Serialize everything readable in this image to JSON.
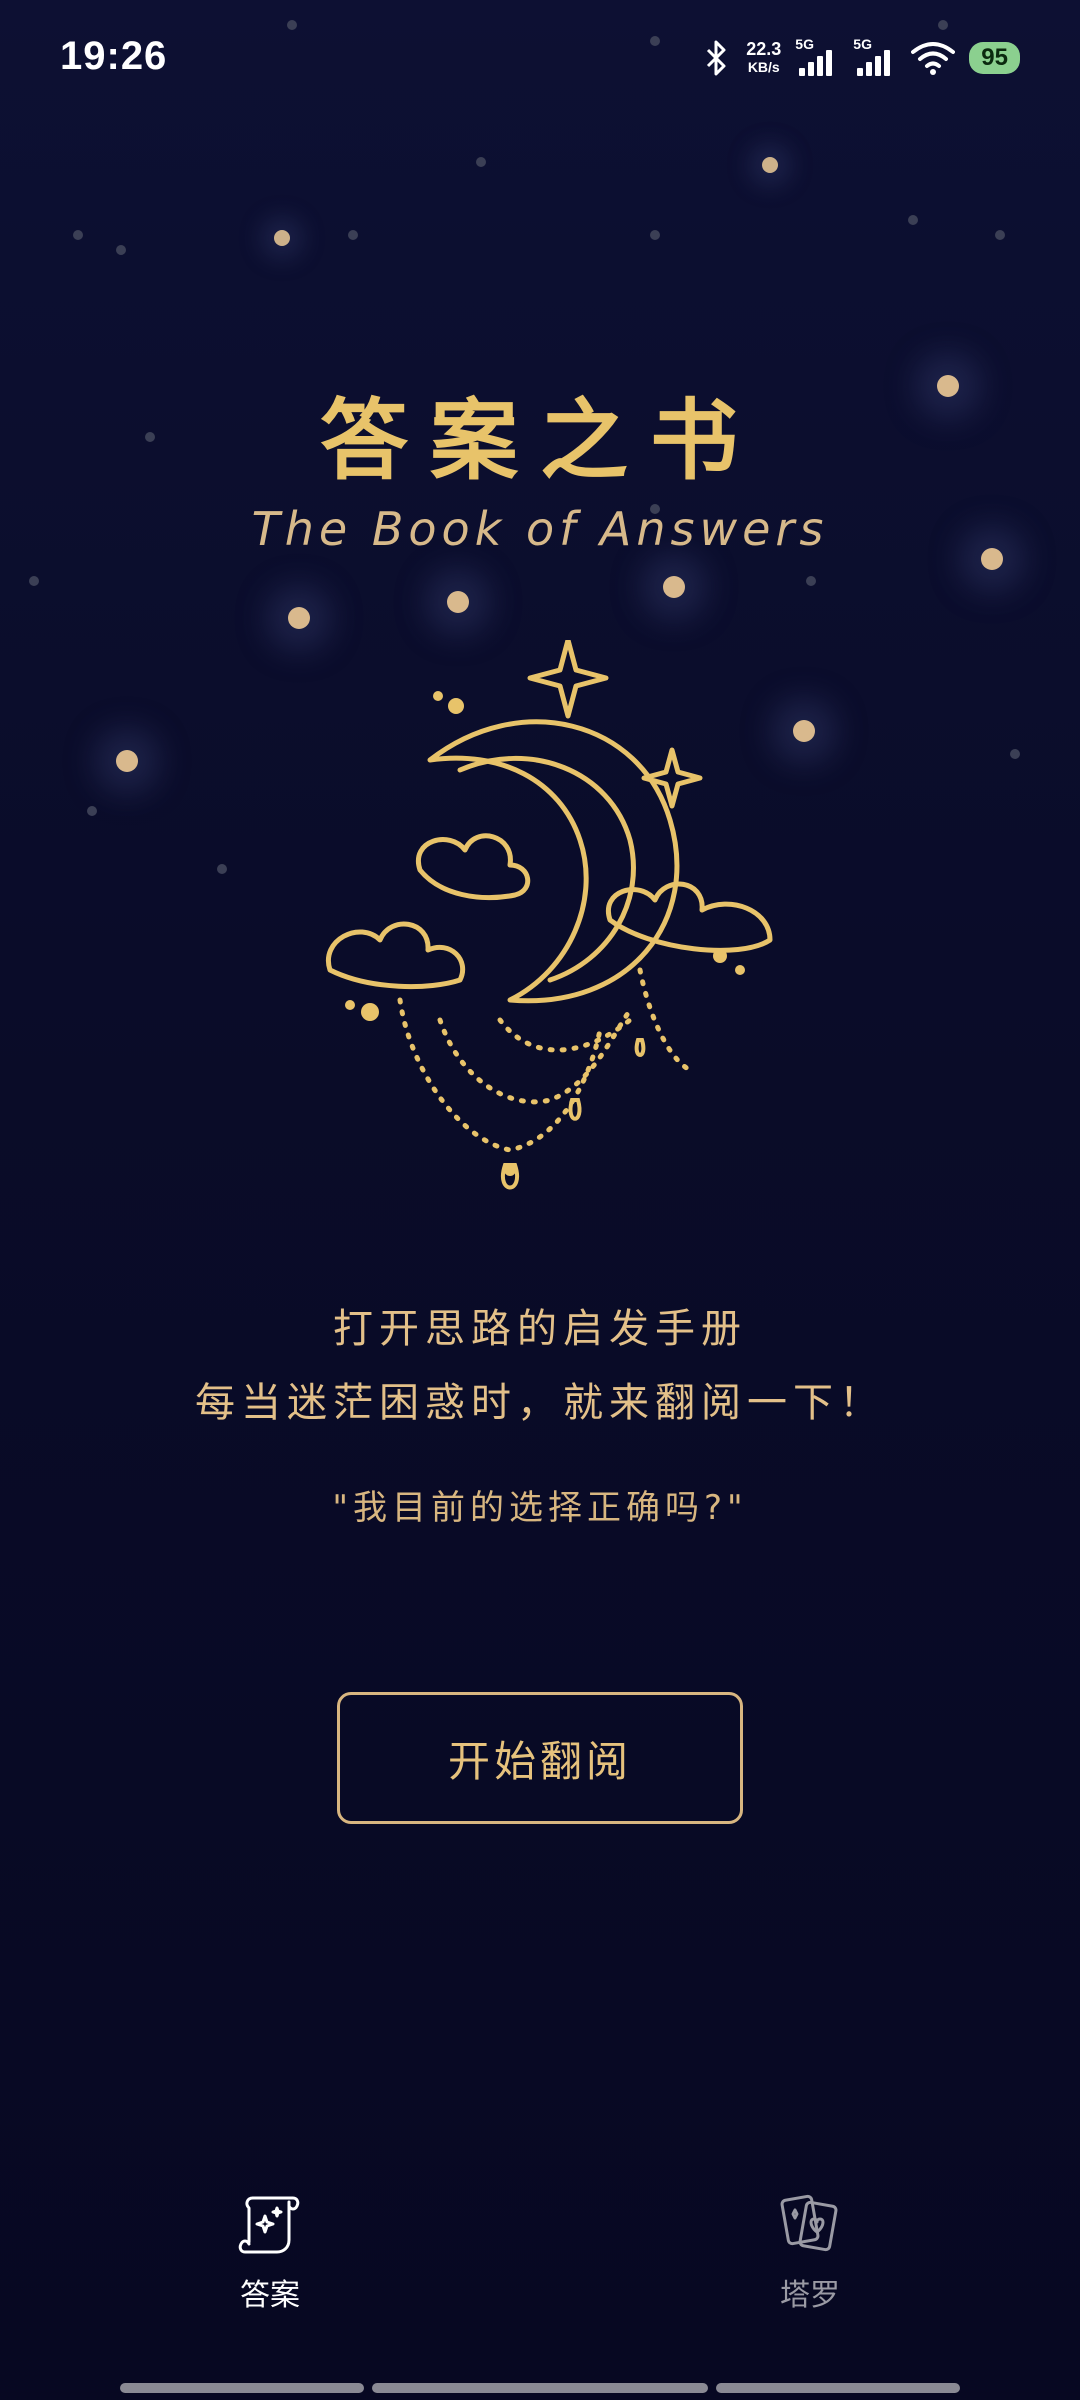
{
  "status_bar": {
    "time": "19:26",
    "net_speed_value": "22.3",
    "net_speed_unit": "KB/s",
    "signal_1_label": "5G",
    "signal_2_label": "5G",
    "battery": "95",
    "icons": [
      "bluetooth-icon",
      "signal-icon",
      "signal-icon",
      "wifi-icon",
      "battery-icon"
    ]
  },
  "header": {
    "title_cn": "答案之书",
    "title_en": "The Book of Answers"
  },
  "illustration": {
    "icon": "crescent-moon-icon",
    "color": "#e8c36a"
  },
  "intro": {
    "line1": "打开思路的启发手册",
    "line2": "每当迷茫困惑时，就来翻阅一下！",
    "example_question": "\"我目前的选择正确吗?\""
  },
  "start_button": {
    "label": "开始翻阅"
  },
  "tab_bar": {
    "tabs": [
      {
        "label": "答案",
        "icon": "scroll-icon",
        "active": true
      },
      {
        "label": "塔罗",
        "icon": "tarot-cards-icon",
        "active": false
      }
    ]
  },
  "colors": {
    "background": "#0a0c29",
    "accent_gold": "#e8c36a",
    "tab_active": "#ffffff",
    "tab_inactive": "#9a9aa4"
  }
}
